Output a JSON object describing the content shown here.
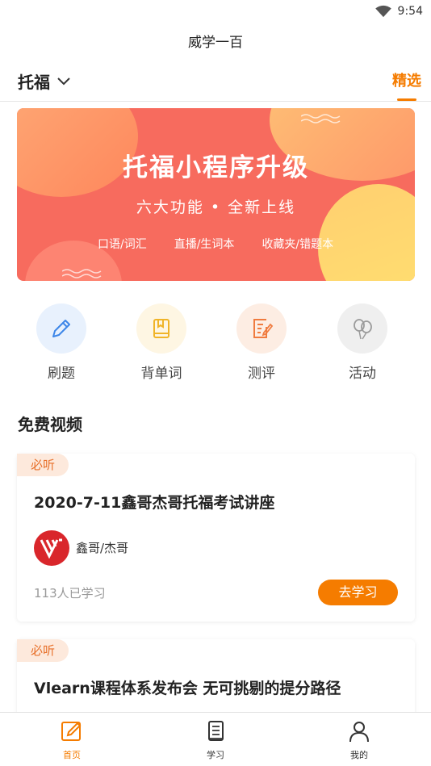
{
  "status_bar": {
    "time": "9:54",
    "wifi_icon": "wifi-icon"
  },
  "app": {
    "title": "威学一百"
  },
  "header": {
    "exam_selector": "托福",
    "featured_tab": "精选",
    "accent": "#f57c00"
  },
  "banner": {
    "headline": "托福小程序升级",
    "subtitle": "六大功能 • 全新上线",
    "features": [
      "口语/词汇",
      "直播/生词本",
      "收藏夹/错题本"
    ]
  },
  "quick_actions": [
    {
      "label": "刷题",
      "icon": "pencil-icon",
      "color": "#3d86e8",
      "bg": "#e8f1fd"
    },
    {
      "label": "背单词",
      "icon": "book-icon",
      "color": "#f0b428",
      "bg": "#fef6e3"
    },
    {
      "label": "测评",
      "icon": "checklist-icon",
      "color": "#f07b3f",
      "bg": "#fdede3"
    },
    {
      "label": "活动",
      "icon": "balloons-icon",
      "color": "#9a9a9a",
      "bg": "#efefef"
    }
  ],
  "free_videos": {
    "title": "免费视频",
    "items": [
      {
        "tag": "必听",
        "title": "2020-7-11鑫哥杰哥托福考试讲座",
        "teacher": "鑫哥/杰哥",
        "learners": "113人已学习",
        "button": "去学习"
      },
      {
        "tag": "必听",
        "title": "Vlearn课程体系发布会 无可挑剔的提分路径"
      }
    ]
  },
  "bottom_nav": [
    {
      "label": "首页",
      "icon": "home-edit-icon",
      "active": true
    },
    {
      "label": "学习",
      "icon": "notebook-icon",
      "active": false
    },
    {
      "label": "我的",
      "icon": "user-icon",
      "active": false
    }
  ]
}
